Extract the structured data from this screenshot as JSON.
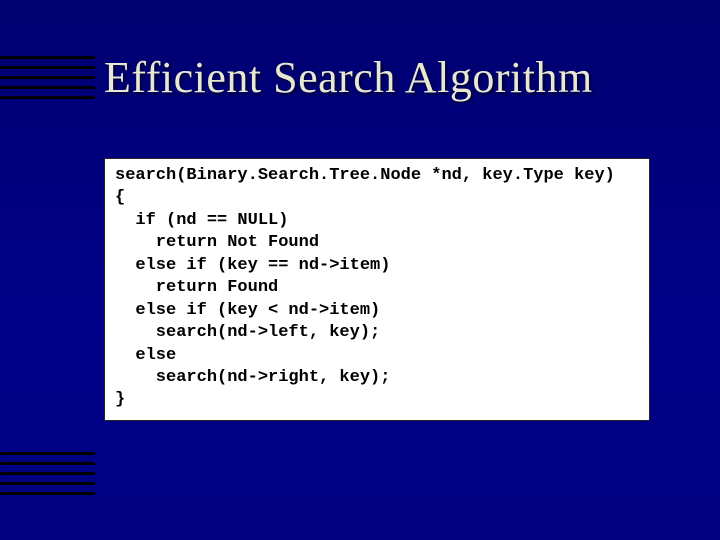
{
  "slide": {
    "title": "Efficient Search Algorithm",
    "code": "search(Binary.Search.Tree.Node *nd, key.Type key)\n{\n  if (nd == NULL)\n    return Not Found\n  else if (key == nd->item)\n    return Found\n  else if (key < nd->item)\n    search(nd->left, key);\n  else\n    search(nd->right, key);\n}"
  }
}
